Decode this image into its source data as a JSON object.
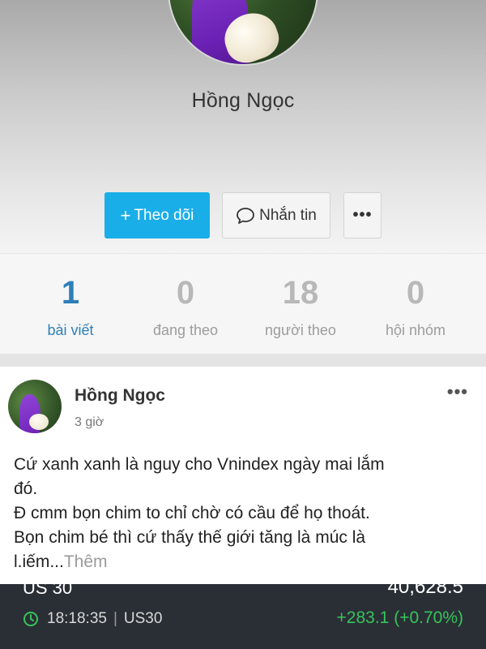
{
  "profile": {
    "name": "Hồng Ngọc",
    "follow_button": "Theo dõi",
    "follow_plus": "+",
    "message_button": "Nhắn tin",
    "more_button": "•••"
  },
  "stats": [
    {
      "value": "1",
      "label": "bài viết",
      "active": true
    },
    {
      "value": "0",
      "label": "đang theo",
      "active": false
    },
    {
      "value": "18",
      "label": "người theo",
      "active": false
    },
    {
      "value": "0",
      "label": "hội nhóm",
      "active": false
    }
  ],
  "post": {
    "author": "Hồng Ngọc",
    "time": "3 giờ",
    "more": "•••",
    "lines": [
      "Cứ xanh xanh là nguy cho Vnindex ngày mai lắm",
      "đó.",
      "Đ cmm bọn chim to chỉ chờ có cầu để họ thoát.",
      "Bọn chim bé thì cứ thấy thế giới tăng là múc là",
      "l.iếm..."
    ],
    "see_more": "Thêm"
  },
  "ticker": {
    "symbol_top": "US 30",
    "value_top": "40,628.5",
    "time": "18:18:35",
    "symbol": "US30",
    "change": "+283.1 (+0.70%)",
    "change_color": "#37c45a",
    "background": "#2a2f36"
  },
  "colors": {
    "accent": "#1aaee8",
    "stat_active": "#2d7fb8"
  }
}
